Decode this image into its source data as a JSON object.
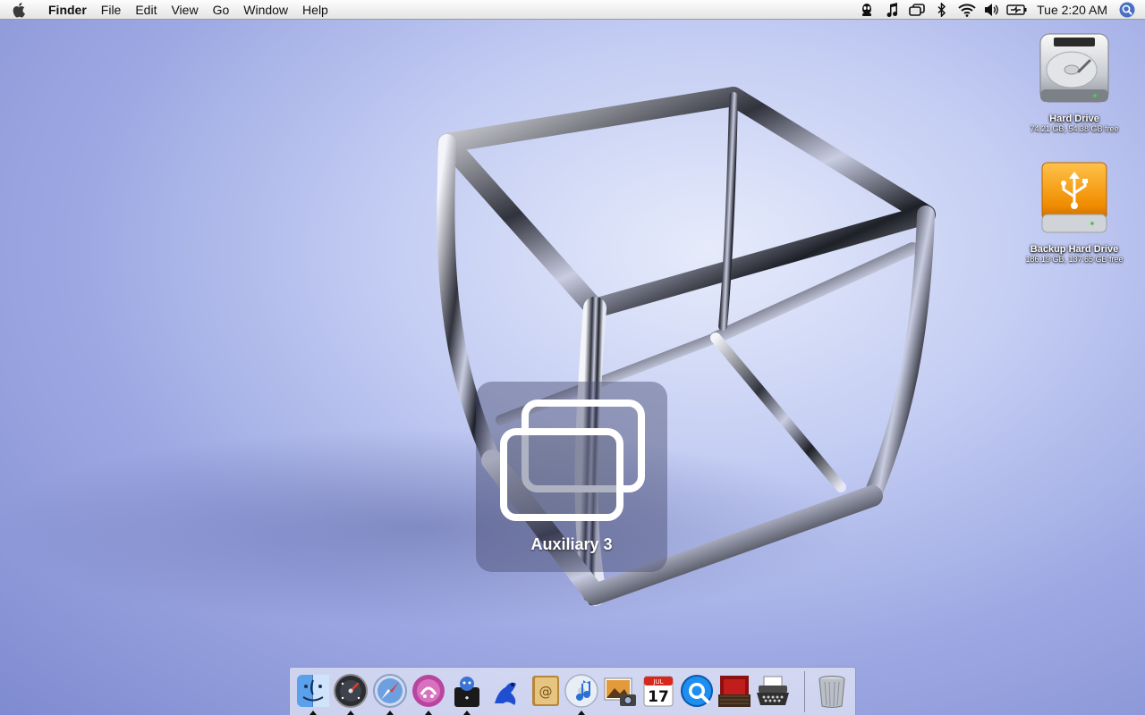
{
  "menubar": {
    "apple_icon": "apple-logo-icon",
    "app_name": "Finder",
    "menus": [
      "File",
      "Edit",
      "View",
      "Go",
      "Window",
      "Help"
    ],
    "status_icons": [
      "alien-monitor-icon",
      "music-note-icon",
      "spaces-icon",
      "bluetooth-icon",
      "wifi-icon",
      "volume-icon",
      "battery-charging-icon"
    ],
    "clock": "Tue 2:20 AM",
    "spotlight_icon": "spotlight-search-icon"
  },
  "desktop": {
    "icons": [
      {
        "label": "Hard Drive",
        "sub": "74.21 GB, 54.38 GB free",
        "icon": "hard-drive-icon"
      },
      {
        "label": "Backup Hard Drive",
        "sub": "186.19 GB, 137.65 GB free",
        "icon": "usb-drive-icon"
      }
    ]
  },
  "space_switch": {
    "label": "Auxiliary 3",
    "icon": "spaces-icon"
  },
  "dock": {
    "items": [
      {
        "name": "finder",
        "icon": "finder-icon",
        "running": true
      },
      {
        "name": "dashboard",
        "icon": "dashboard-icon",
        "running": true
      },
      {
        "name": "safari",
        "icon": "safari-icon",
        "running": true
      },
      {
        "name": "adium",
        "icon": "adium-icon",
        "running": true
      },
      {
        "name": "apple-account",
        "icon": "apple-tshirt-icon",
        "running": true
      },
      {
        "name": "frog",
        "icon": "blue-frog-icon",
        "running": false
      },
      {
        "name": "address-book",
        "icon": "address-book-icon",
        "running": false
      },
      {
        "name": "itunes",
        "icon": "itunes-icon",
        "running": true
      },
      {
        "name": "iphoto",
        "icon": "iphoto-icon",
        "running": false
      },
      {
        "name": "ical",
        "icon": "ical-icon",
        "running": false,
        "month": "JUL",
        "day": "17"
      },
      {
        "name": "quicktime",
        "icon": "quicktime-icon",
        "running": false
      },
      {
        "name": "front-row",
        "icon": "front-row-icon",
        "running": false
      },
      {
        "name": "typewriter",
        "icon": "typewriter-icon",
        "running": false
      },
      {
        "name": "trash",
        "icon": "trash-icon",
        "running": false
      }
    ]
  }
}
